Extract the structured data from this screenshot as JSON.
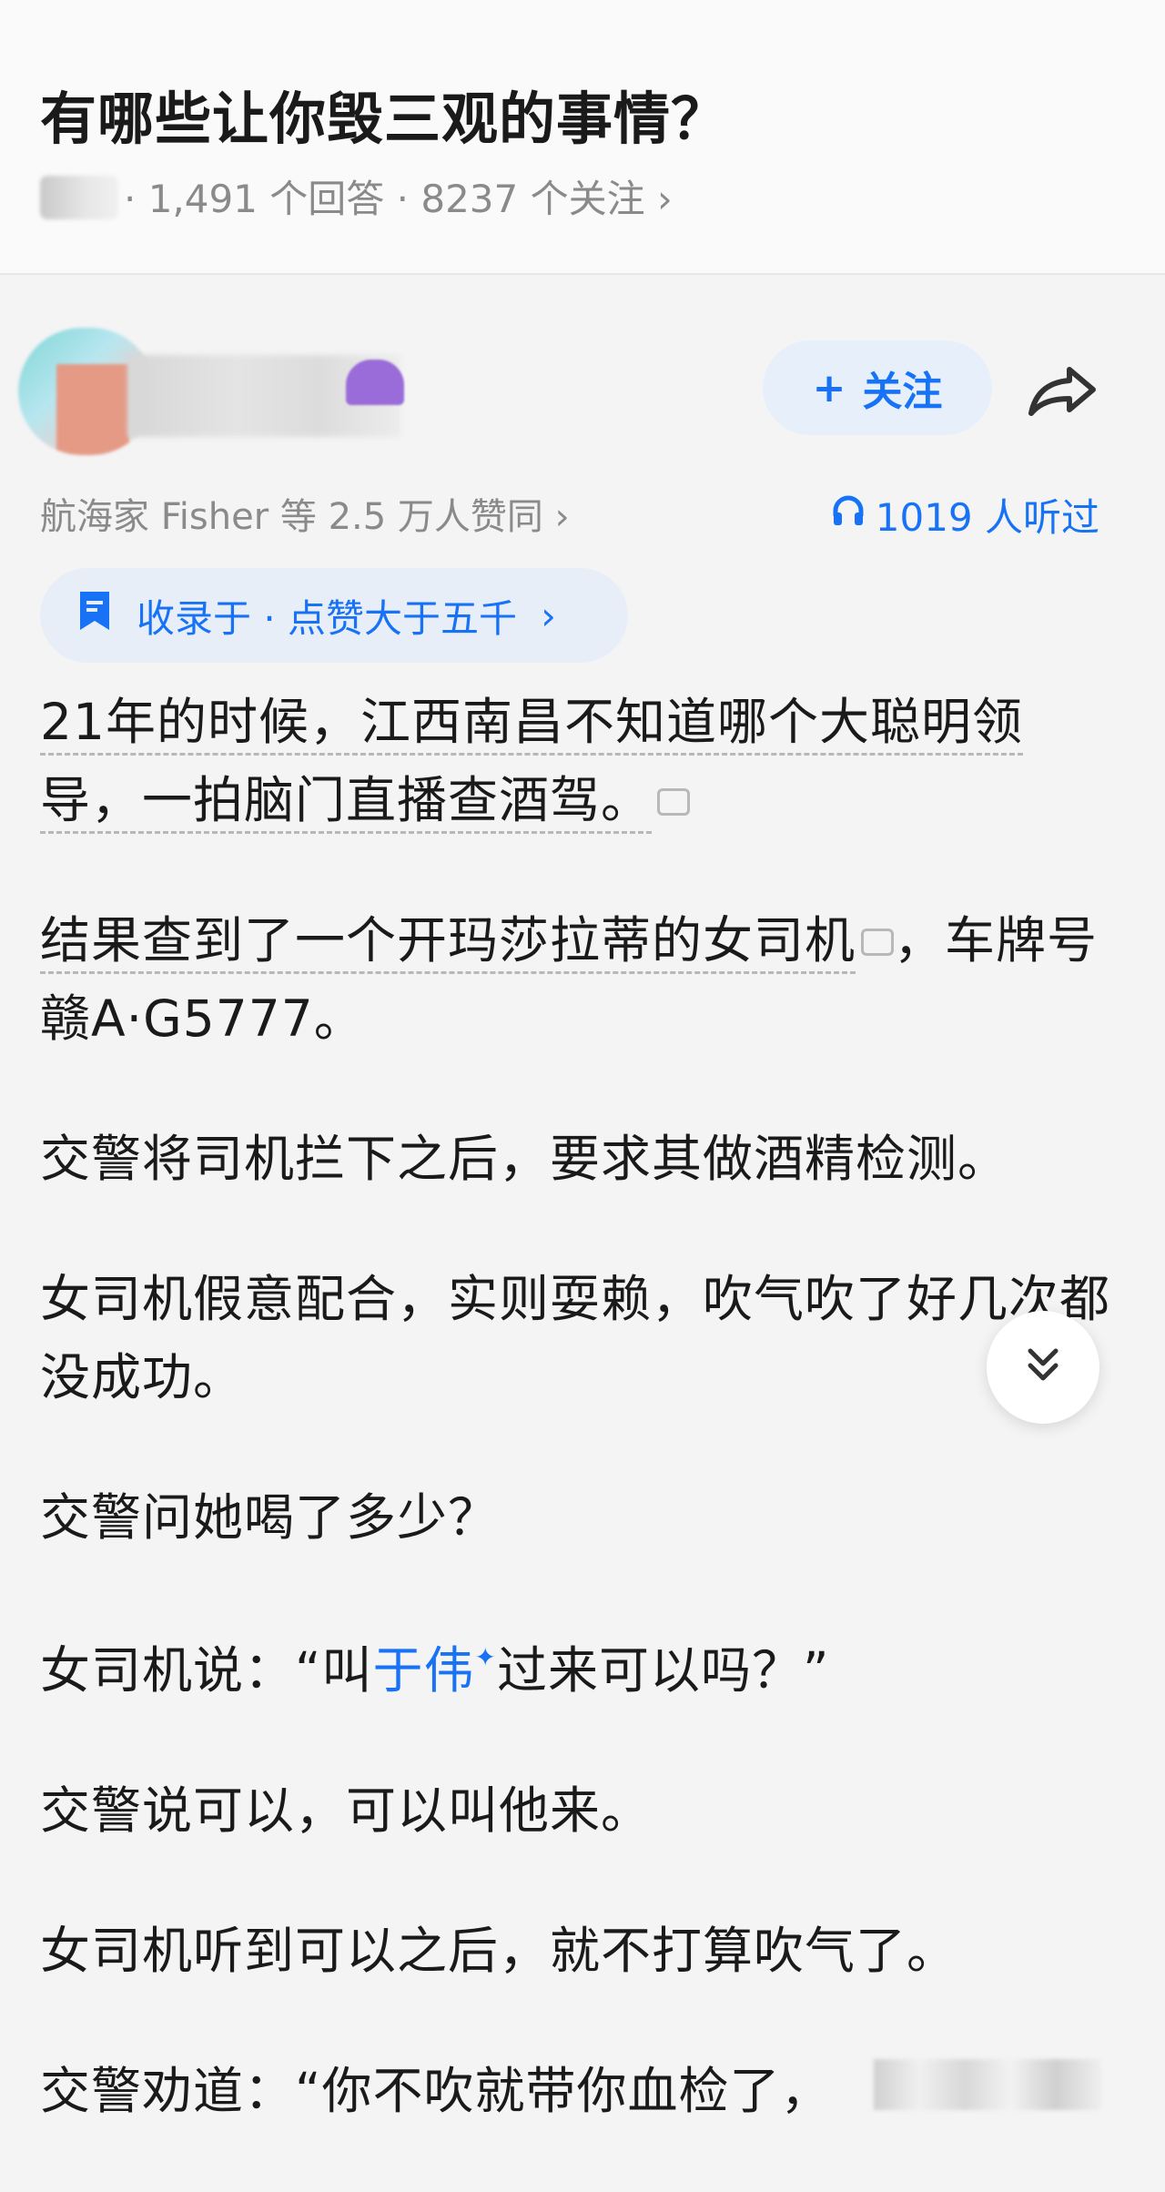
{
  "question": {
    "title": "有哪些让你毁三观的事情？",
    "meta": "· 1,491 个回答 · 8237 个关注",
    "chevron": "›"
  },
  "author": {
    "follow_label": "关注",
    "follow_plus": "+",
    "endorse_text": "航海家 Fisher 等 2.5 万人赞同",
    "endorse_chevron": "›",
    "listen_count": "1019 人听过"
  },
  "collection": {
    "label": "收录于 · 点赞大于五千",
    "chevron": "›"
  },
  "answer": {
    "p1": "21年的时候，江西南昌不知道哪个大聪明领导，一拍脑门直播查酒驾。",
    "p2a": "结果查到了一个开玛莎拉蒂的女司机",
    "p2b": "，车牌号赣A·G5777。",
    "p3": "交警将司机拦下之后，要求其做酒精检测。",
    "p4": "女司机假意配合，实则耍赖，吹气吹了好几次都没成功。",
    "p5": "交警问她喝了多少？",
    "p6a": "女司机说：“叫",
    "p6_link": "于伟",
    "p6_spark": "✦",
    "p6b": "过来可以吗？”",
    "p7": "交警说可以，可以叫他来。",
    "p8": "女司机听到可以之后，就不打算吹气了。",
    "p9": "交警劝道：“你不吹就带你血检了，"
  },
  "colors": {
    "accent": "#1772f6",
    "muted": "#8a8a8a",
    "text": "#1a1a1a",
    "chip_bg": "#e8eef8"
  },
  "icons": [
    "share-icon",
    "headphones-icon",
    "bookmark-icon",
    "comment-icon",
    "double-chevron-down-icon"
  ]
}
